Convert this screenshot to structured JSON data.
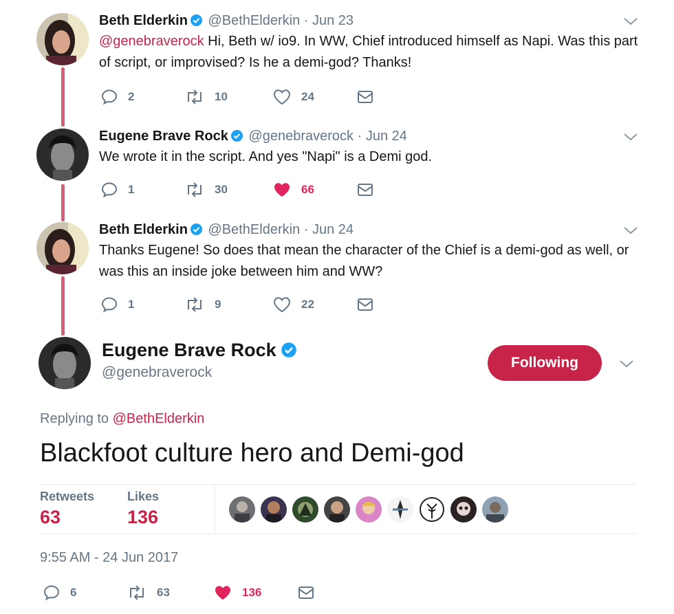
{
  "thread": [
    {
      "name": "Beth Elderkin",
      "handle": "@BethElderkin",
      "separator": "·",
      "date": "Jun 23",
      "mention": "@genebraverock",
      "text": " Hi, Beth w/ io9. In WW, Chief introduced himself as Napi. Was this part of script, or improvised? Is he a demi-god? Thanks!",
      "replies": "2",
      "retweets": "10",
      "likes": "24",
      "liked": false
    },
    {
      "name": "Eugene Brave Rock",
      "handle": "@genebraverock",
      "separator": "·",
      "date": "Jun 24",
      "mention": "",
      "text": "We wrote it in the script. And yes \"Napi\" is a Demi god.",
      "replies": "1",
      "retweets": "30",
      "likes": "66",
      "liked": true
    },
    {
      "name": "Beth Elderkin",
      "handle": "@BethElderkin",
      "separator": "·",
      "date": "Jun 24",
      "mention": "",
      "text": "Thanks Eugene! So does that mean the character of the Chief is a demi-god as well, or was this an inside joke between him and WW?",
      "replies": "1",
      "retweets": "9",
      "likes": "22",
      "liked": false
    }
  ],
  "main": {
    "name": "Eugene Brave Rock",
    "handle": "@genebraverock",
    "follow_label": "Following",
    "replying_prefix": "Replying to ",
    "replying_to": "@BethElderkin",
    "text": "Blackfoot culture hero and Demi-god",
    "retweets_label": "Retweets",
    "retweets_count": "63",
    "likes_label": "Likes",
    "likes_count": "136",
    "timestamp": "9:55 AM - 24 Jun 2017",
    "replies": "6",
    "action_retweets": "63",
    "action_likes": "136"
  },
  "colors": {
    "accent": "#c8244a",
    "like": "#e0245e",
    "verified": "#1da1f2",
    "muted": "#657786",
    "thread_line": "#d2607a"
  }
}
